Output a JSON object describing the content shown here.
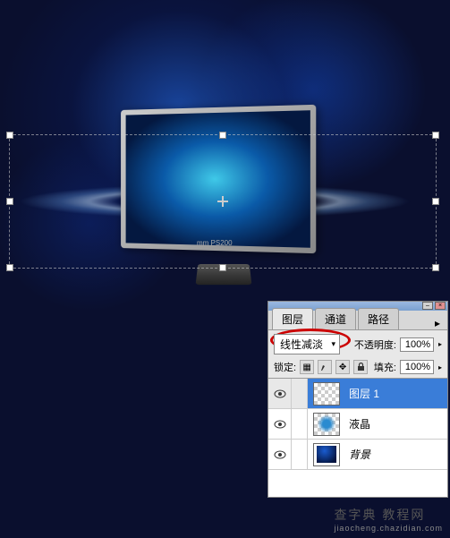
{
  "panel": {
    "tabs": {
      "layers": "图层",
      "channels": "通道",
      "paths": "路径"
    },
    "blend_mode": "线性减淡",
    "opacity_label": "不透明度:",
    "opacity_value": "100%",
    "lock_label": "锁定:",
    "fill_label": "填充:",
    "fill_value": "100%",
    "layers": [
      {
        "name": "图层 1"
      },
      {
        "name": "液晶"
      },
      {
        "name": "背景"
      }
    ]
  },
  "monitor_brand": "mm PS200",
  "watermark": {
    "main": "查字典 教程网",
    "sub": "jiaocheng.chazidian.com"
  }
}
